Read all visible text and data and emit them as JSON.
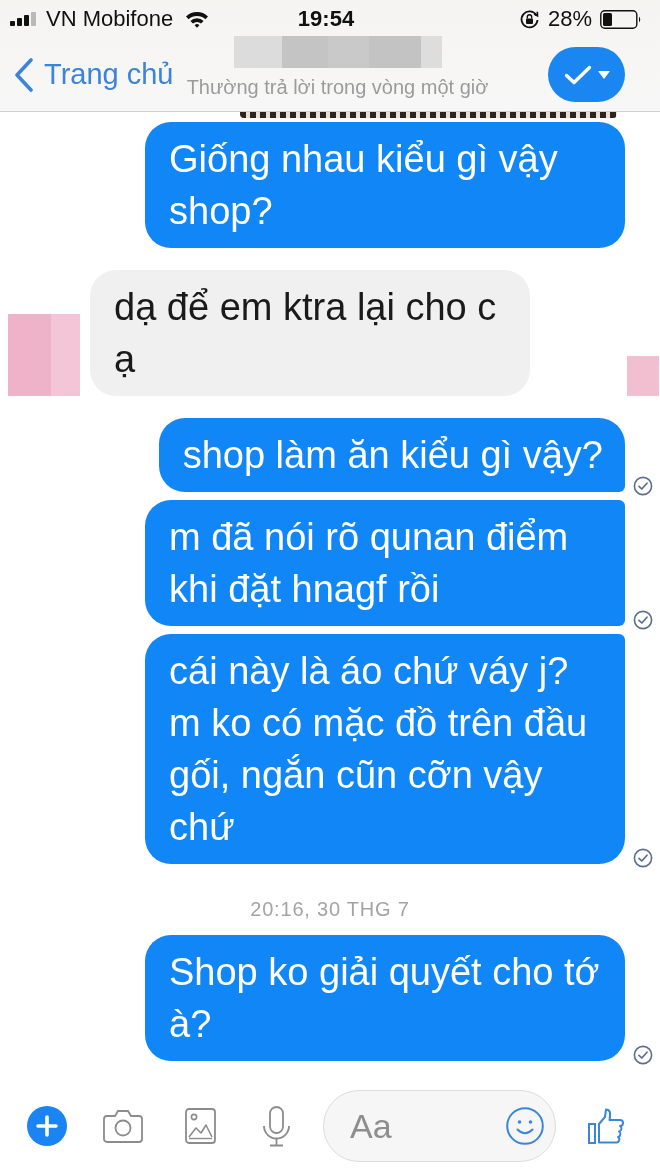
{
  "status_bar": {
    "carrier": "VN Mobifone",
    "time": "19:54",
    "battery": "28%"
  },
  "header": {
    "back_label": "Trang chủ",
    "subtitle": "Thường trả lời trong vòng một giờ"
  },
  "messages": [
    {
      "kind": "sent",
      "text": "Giống nhau kiểu gì vậy shop?",
      "delivered": false
    },
    {
      "kind": "received",
      "text": "dạ để em ktra lại cho c ạ",
      "seen_avatar": true
    },
    {
      "kind": "sent",
      "text": "shop làm ăn kiểu gì vậy?",
      "delivered": true
    },
    {
      "kind": "sent",
      "text": "m đã nói rõ qunan điểm khi đặt hnagf rồi",
      "delivered": true
    },
    {
      "kind": "sent",
      "text": "cái này là áo chứ váy j? m ko có mặc đồ trên đầu gối, ngắn cũn cỡn vậy chứ",
      "delivered": true
    },
    {
      "kind": "timestamp",
      "text": "20:16, 30 THG 7"
    },
    {
      "kind": "sent",
      "text": "Shop ko giải quyết cho tớ à?",
      "delivered": true
    }
  ],
  "composer": {
    "placeholder": "Aa"
  }
}
